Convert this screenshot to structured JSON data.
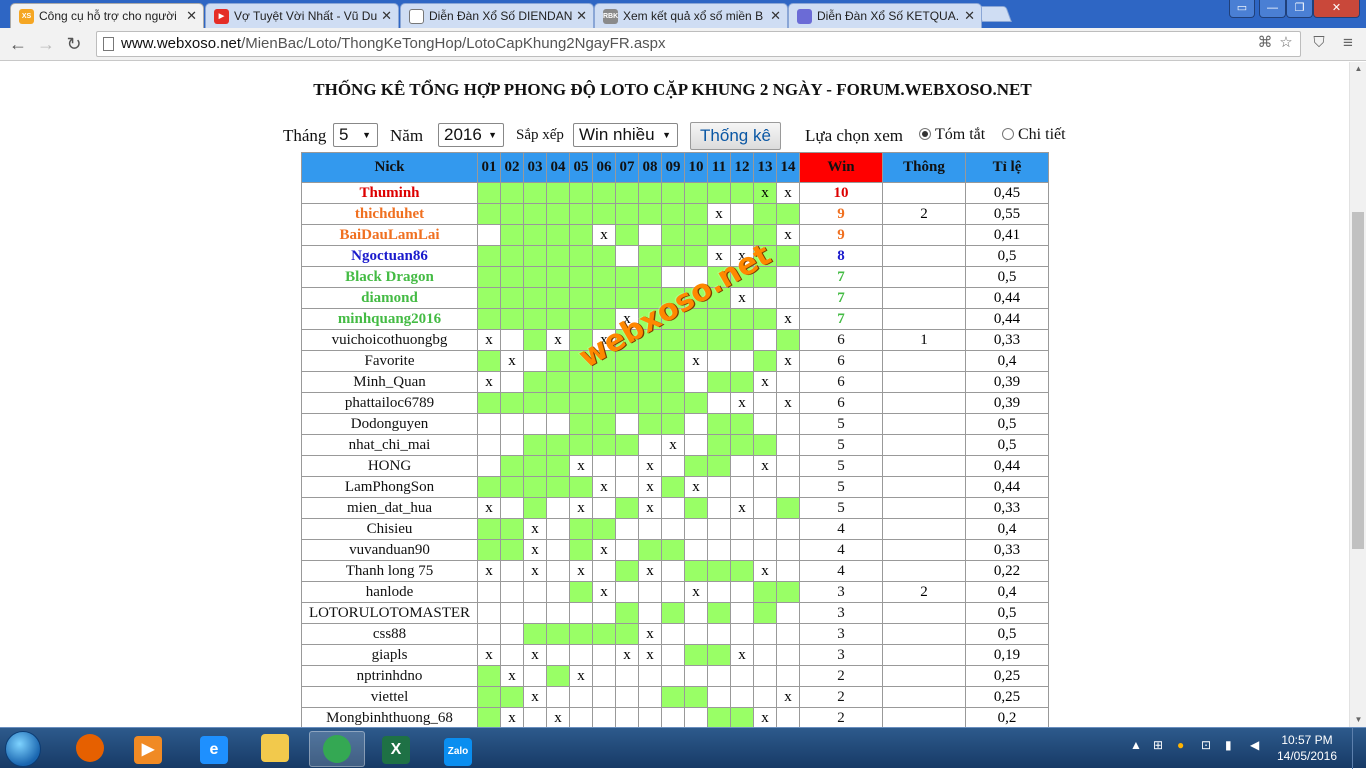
{
  "browser": {
    "tabs": [
      {
        "title": "Công cụ hỗ trợ cho người",
        "favicon": "XS",
        "color": "#f5a623",
        "active": true
      },
      {
        "title": "Vợ Tuyệt Vời Nhất - Vũ Du",
        "favicon": "▶",
        "color": "#e52d27",
        "active": false
      },
      {
        "title": "Diễn Đàn Xổ Số DIENDAN",
        "favicon": "",
        "color": "#ffffff",
        "active": false
      },
      {
        "title": "Xem kết quả xổ số miền B",
        "favicon": "RBK",
        "color": "#8a8a8a",
        "active": false
      },
      {
        "title": "Diễn Đàn Xổ Số KETQUA.",
        "favicon": "",
        "color": "#6b6bd6",
        "active": false
      }
    ],
    "url_host": "www.webxoso.net",
    "url_path": "/MienBac/Loto/ThongKeTongHop/LotoCapKhung2NgayFR.aspx"
  },
  "page": {
    "title": "THỐNG KÊ TỔNG HỢP PHONG ĐỘ LOTO CẶP KHUNG 2 NGÀY - FORUM.WEBXOSO.NET",
    "filters": {
      "month_label": "Tháng",
      "month_value": "5",
      "year_label": "Năm",
      "year_value": "2016",
      "sort_label": "Sắp xếp",
      "sort_value": "Win nhiều",
      "submit_label": "Thống kê",
      "view_label": "Lựa chọn xem",
      "view_summary": "Tóm tắt",
      "view_detail": "Chi tiết",
      "view_selected": "summary"
    },
    "watermark": "webxoso.net"
  },
  "table": {
    "headers": {
      "nick": "Nick",
      "days": [
        "01",
        "02",
        "03",
        "04",
        "05",
        "06",
        "07",
        "08",
        "09",
        "10",
        "11",
        "12",
        "13",
        "14"
      ],
      "win": "Win",
      "thong": "Thông",
      "ratio": "Tỉ lệ"
    },
    "rows": [
      {
        "nick": "Thuminh",
        "color": "#dd0000",
        "bold": true,
        "cells": "ggggggggggggXx",
        "win": "10",
        "thong": "",
        "ratio": "0,45"
      },
      {
        "nick": "thichduhet",
        "color": "#f07020",
        "bold": true,
        "cells": "ggggggggggx.gg",
        "win": "9",
        "thong": "2",
        "ratio": "0,55"
      },
      {
        "nick": "BaiDauLamLai",
        "color": "#f07020",
        "bold": true,
        "cells": ".ggggxg.gggggx",
        "win": "9",
        "thong": "",
        "ratio": "0,41"
      },
      {
        "nick": "Ngoctuan86",
        "color": "#1a1acc",
        "bold": true,
        "cells": "gggggg.gggxxgg",
        "win": "8",
        "thong": "",
        "ratio": "0,5"
      },
      {
        "nick": "Black Dragon",
        "color": "#44bb44",
        "bold": true,
        "cells": "gggggggg..ggg.",
        "win": "7",
        "thong": "",
        "ratio": "0,5"
      },
      {
        "nick": "diamond",
        "color": "#44bb44",
        "bold": true,
        "cells": "gggggggggggx..",
        "win": "7",
        "thong": "",
        "ratio": "0,44"
      },
      {
        "nick": "minhquang2016",
        "color": "#44bb44",
        "bold": true,
        "cells": "ggggggxggggggx",
        "win": "7",
        "thong": "",
        "ratio": "0,44"
      },
      {
        "nick": "vuichoicothuongbg",
        "color": "#111111",
        "bold": false,
        "cells": "x.gxgxgggggg.g",
        "win": "6",
        "thong": "1",
        "ratio": "0,33"
      },
      {
        "nick": "Favorite",
        "color": "#111111",
        "bold": false,
        "cells": "gx.ggggggx..gx",
        "win": "6",
        "thong": "",
        "ratio": "0,4"
      },
      {
        "nick": "Minh_Quan",
        "color": "#111111",
        "bold": false,
        "cells": "x.ggggggg.ggx.",
        "win": "6",
        "thong": "",
        "ratio": "0,39"
      },
      {
        "nick": "phattailoc6789",
        "color": "#111111",
        "bold": false,
        "cells": "gggggggggg.x.x",
        "win": "6",
        "thong": "",
        "ratio": "0,39"
      },
      {
        "nick": "Dodonguyen",
        "color": "#111111",
        "bold": false,
        "cells": "....gg.gg.gg..",
        "win": "5",
        "thong": "",
        "ratio": "0,5"
      },
      {
        "nick": "nhat_chi_mai",
        "color": "#111111",
        "bold": false,
        "cells": "..ggggg.x.ggg.",
        "win": "5",
        "thong": "",
        "ratio": "0,5"
      },
      {
        "nick": "HONG",
        "color": "#111111",
        "bold": false,
        "cells": ".gggx..x.gg.x.",
        "win": "5",
        "thong": "",
        "ratio": "0,44"
      },
      {
        "nick": "LamPhongSon",
        "color": "#111111",
        "bold": false,
        "cells": "gggggx.xgx....",
        "win": "5",
        "thong": "",
        "ratio": "0,44"
      },
      {
        "nick": "mien_dat_hua",
        "color": "#111111",
        "bold": false,
        "cells": "x.g.x.gx.g.x.g",
        "win": "5",
        "thong": "",
        "ratio": "0,33"
      },
      {
        "nick": "Chisieu",
        "color": "#111111",
        "bold": false,
        "cells": "ggx.gg........",
        "win": "4",
        "thong": "",
        "ratio": "0,4"
      },
      {
        "nick": "vuvanduan90",
        "color": "#111111",
        "bold": false,
        "cells": "ggx.gx.gg.....",
        "win": "4",
        "thong": "",
        "ratio": "0,33"
      },
      {
        "nick": "Thanh long 75",
        "color": "#111111",
        "bold": false,
        "cells": "x.x.x.gx.gggx.",
        "win": "4",
        "thong": "",
        "ratio": "0,22"
      },
      {
        "nick": "hanlode",
        "color": "#111111",
        "bold": false,
        "cells": "....gx...x..gg",
        "win": "3",
        "thong": "2",
        "ratio": "0,4"
      },
      {
        "nick": "LOTORULOTOMASTER",
        "color": "#111111",
        "bold": false,
        "cells": "......g.g.g.g.",
        "win": "3",
        "thong": "",
        "ratio": "0,5"
      },
      {
        "nick": "css88",
        "color": "#111111",
        "bold": false,
        "cells": "..gggggx......",
        "win": "3",
        "thong": "",
        "ratio": "0,5"
      },
      {
        "nick": "giapls",
        "color": "#111111",
        "bold": false,
        "cells": "x.x...xx.ggx..",
        "win": "3",
        "thong": "",
        "ratio": "0,19"
      },
      {
        "nick": "nptrinhdno",
        "color": "#111111",
        "bold": false,
        "cells": "gx.gx.........",
        "win": "2",
        "thong": "",
        "ratio": "0,25"
      },
      {
        "nick": "viettel",
        "color": "#111111",
        "bold": false,
        "cells": "ggx.....gg...x",
        "win": "2",
        "thong": "",
        "ratio": "0,25"
      },
      {
        "nick": "Mongbinhthuong_68",
        "color": "#111111",
        "bold": false,
        "cells": "gx.x......ggx.",
        "win": "2",
        "thong": "",
        "ratio": "0,2"
      }
    ]
  },
  "taskbar": {
    "apps": [
      {
        "name": "firefox",
        "label": "",
        "color": "#e66000"
      },
      {
        "name": "media-player",
        "label": "▶",
        "color": "#f08a24"
      },
      {
        "name": "internet-explorer",
        "label": "e",
        "color": "#1e90ff"
      },
      {
        "name": "file-explorer",
        "label": "",
        "color": "#f2c94c"
      },
      {
        "name": "chrome",
        "label": "",
        "color": "#34a853"
      },
      {
        "name": "excel",
        "label": "X",
        "color": "#1e7145"
      },
      {
        "name": "zalo",
        "label": "Zalo",
        "color": "#0a8ef0"
      }
    ],
    "time": "10:57 PM",
    "date": "14/05/2016"
  }
}
